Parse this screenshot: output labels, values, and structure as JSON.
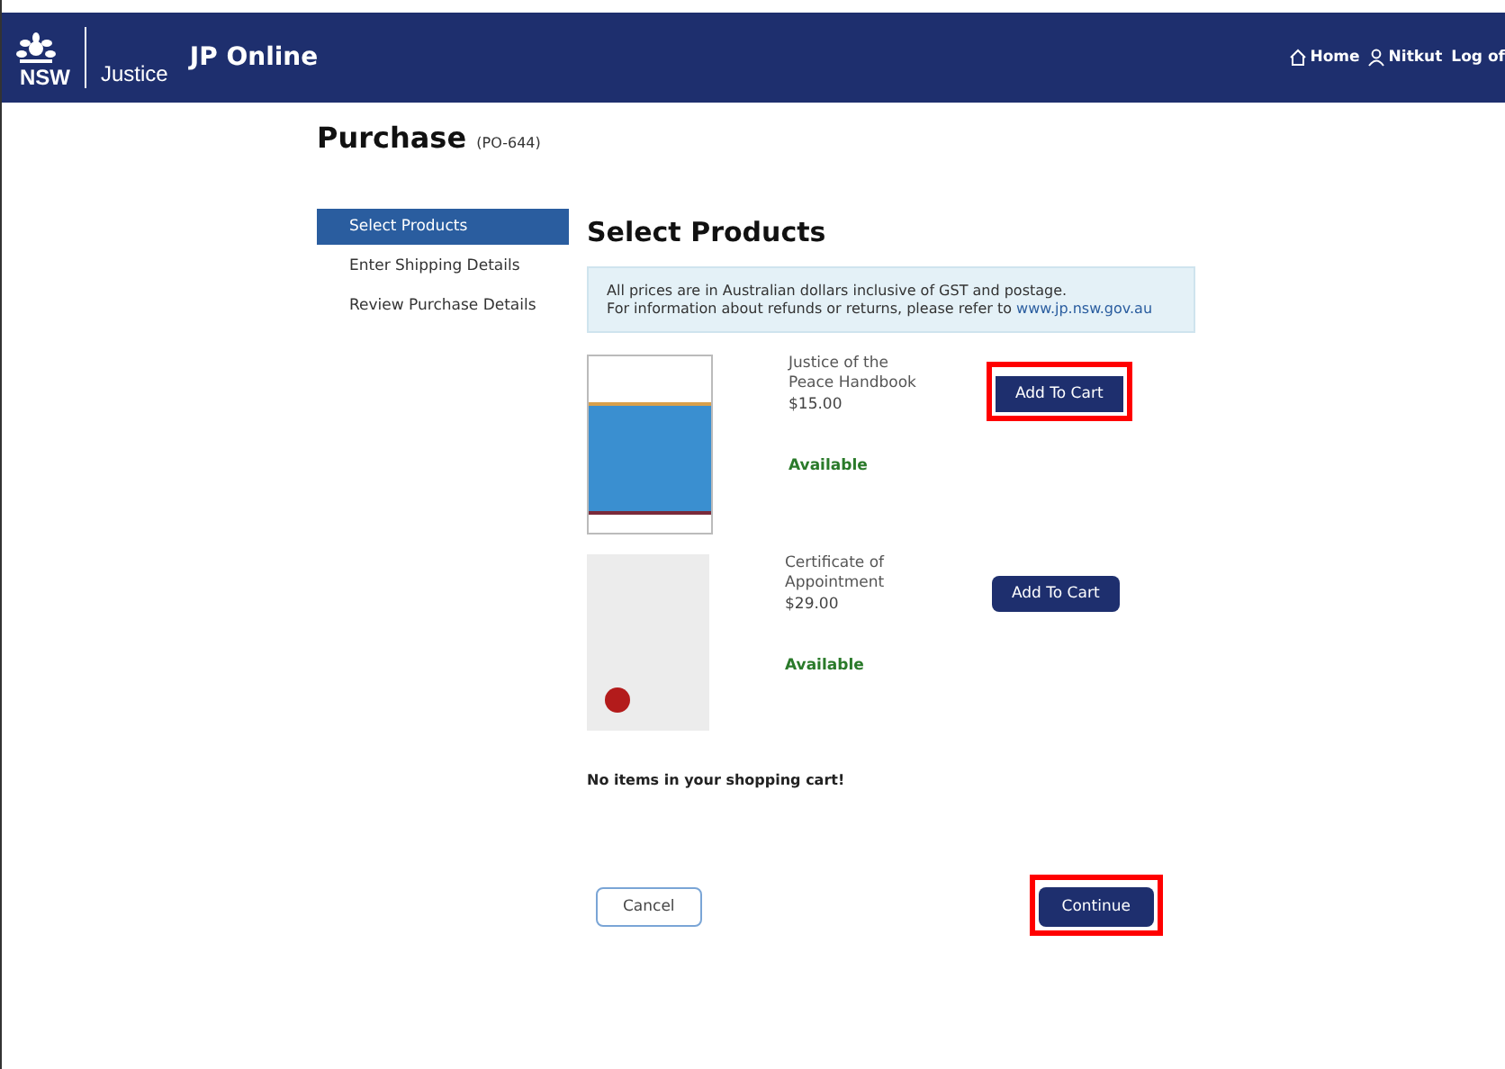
{
  "header": {
    "logo_text": "NSW",
    "department": "Justice",
    "app_title": "JP Online",
    "nav": [
      {
        "kind": "home",
        "label": "Home"
      },
      {
        "kind": "user",
        "label": "Nitkut"
      },
      {
        "kind": "plain",
        "label": "Log of"
      }
    ]
  },
  "page": {
    "title": "Purchase",
    "reference": "(PO-644)"
  },
  "steps": [
    {
      "label": "Select Products",
      "selected": true
    },
    {
      "label": "Enter Shipping Details",
      "selected": false
    },
    {
      "label": "Review Purchase Details",
      "selected": false
    }
  ],
  "section_title": "Select Products",
  "notice": {
    "line_1": "All prices are in Australian dollars inclusive of GST and postage.",
    "line_2": "For information about refunds or returns, please refer to ",
    "link": "www.jp.nsw.gov.au"
  },
  "products": [
    {
      "kind": "handbook",
      "name": "Justice of the Peace Handbook",
      "price": "$15.00",
      "status": "Available",
      "button": "Add To Cart",
      "highlighted": true
    },
    {
      "kind": "certificate",
      "name": "Certificate of Appointment",
      "price": "$29.00",
      "status": "Available",
      "button": "Add To Cart",
      "highlighted": false
    }
  ],
  "cart_message": "No items in your shopping cart!",
  "buttons": [
    {
      "kind": "secondary",
      "label": "Cancel",
      "highlighted": false
    },
    {
      "kind": "primary",
      "label": "Continue",
      "highlighted": true
    }
  ]
}
